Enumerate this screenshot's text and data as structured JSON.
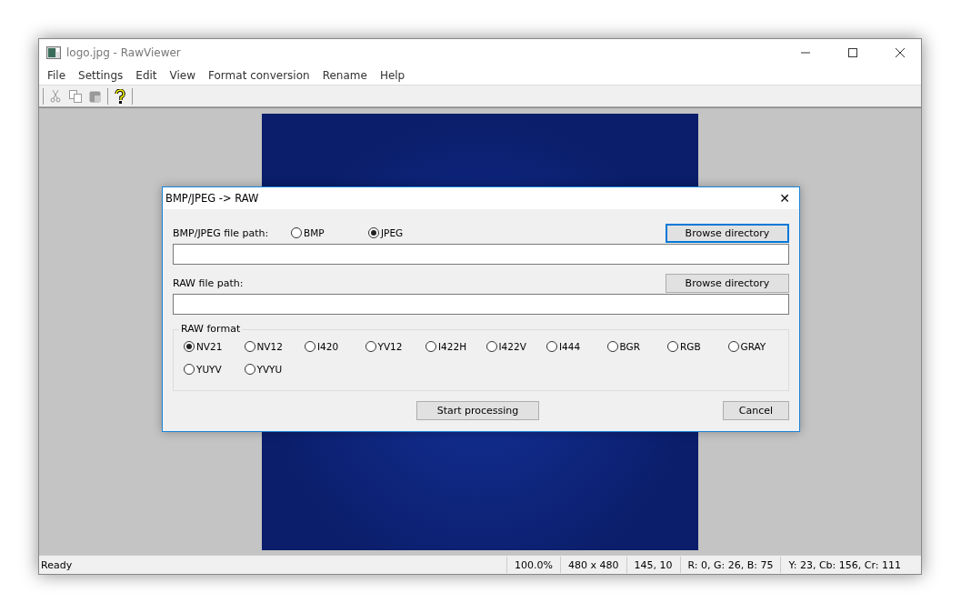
{
  "window": {
    "title": "logo.jpg - RawViewer"
  },
  "menu": [
    "File",
    "Settings",
    "Edit",
    "View",
    "Format conversion",
    "Rename",
    "Help"
  ],
  "dialog": {
    "title": "BMP/JPEG -> RAW",
    "close": "✕",
    "source": {
      "label": "BMP/JPEG file path:",
      "options": [
        {
          "label": "BMP",
          "selected": false
        },
        {
          "label": "JPEG",
          "selected": true
        }
      ],
      "browse": "Browse directory",
      "focused": true
    },
    "target": {
      "label": "RAW file path:",
      "browse": "Browse directory",
      "focused": false
    },
    "raw_format": {
      "label": "RAW format",
      "options": [
        {
          "label": "NV21",
          "selected": true
        },
        {
          "label": "NV12",
          "selected": false
        },
        {
          "label": "I420",
          "selected": false
        },
        {
          "label": "YV12",
          "selected": false
        },
        {
          "label": "I422H",
          "selected": false
        },
        {
          "label": "I422V",
          "selected": false
        },
        {
          "label": "I444",
          "selected": false
        },
        {
          "label": "BGR",
          "selected": false
        },
        {
          "label": "RGB",
          "selected": false
        },
        {
          "label": "GRAY",
          "selected": false
        },
        {
          "label": "YUYV",
          "selected": false
        },
        {
          "label": "YVYU",
          "selected": false
        }
      ]
    },
    "start": "Start processing",
    "cancel": "Cancel"
  },
  "status_bar": {
    "message": "Ready",
    "fields": [
      "100.0%",
      "480 x 480",
      "145, 10",
      "R: 0, G: 26, B: 75",
      "Y: 23, Cb: 156, Cr: 111"
    ]
  }
}
